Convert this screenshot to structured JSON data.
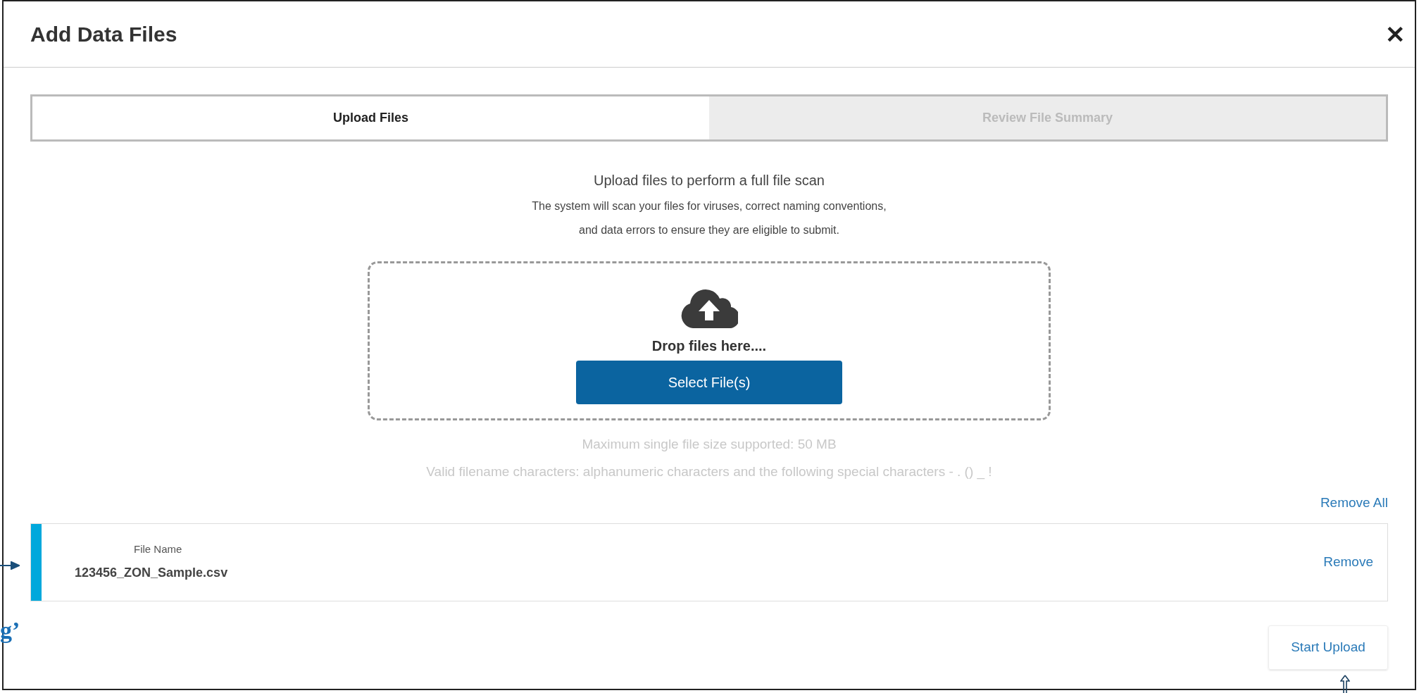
{
  "dialog": {
    "title": "Add Data Files",
    "close": "✕"
  },
  "tabs": [
    {
      "label": "Upload Files",
      "selected": true
    },
    {
      "label": "Review File Summary",
      "selected": false
    }
  ],
  "intro": {
    "heading": "Upload files to perform a full file scan",
    "lines": [
      "The system will scan your files for viruses, correct naming conventions,",
      "and data errors to ensure they are eligible to submit."
    ]
  },
  "drop_zone": {
    "label": "Drop files here....",
    "button": "Select File(s)"
  },
  "notes": [
    "Maximum single file size supported: 50 MB",
    "Valid filename characters: alphanumeric characters and the following special characters - . () _ !"
  ],
  "remove_all": "Remove All",
  "files": [
    {
      "label": "File Name",
      "name": "123456_ZON_Sample.csv",
      "action": "Remove"
    }
  ],
  "start_upload": "Start Upload",
  "annotation": {
    "text": "g’"
  }
}
